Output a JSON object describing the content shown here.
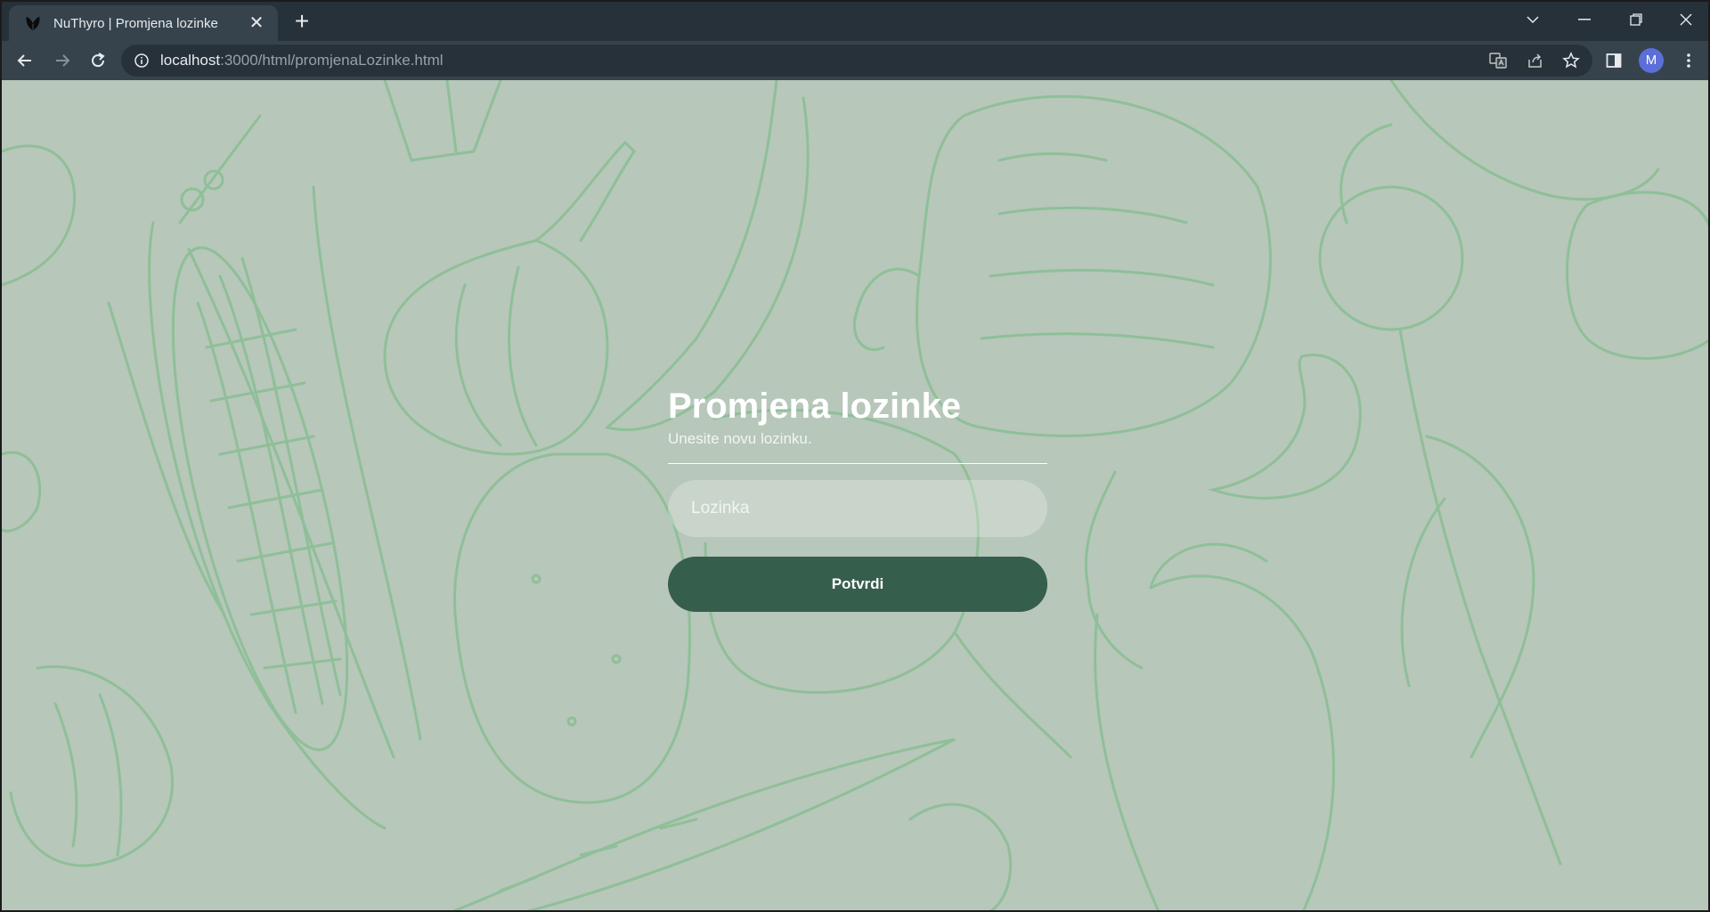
{
  "browser": {
    "tab": {
      "title": "NuThyro | Promjena lozinke"
    },
    "url": {
      "host": "localhost",
      "path": ":3000/html/promjenaLozinke.html"
    },
    "profile_initial": "M"
  },
  "page": {
    "heading": "Promjena lozinke",
    "subtitle": "Unesite novu lozinku.",
    "password_field": {
      "placeholder": "Lozinka",
      "value": ""
    },
    "submit_label": "Potvrdi"
  },
  "colors": {
    "background": "#b7c7ba",
    "illustration": "#8fbf98",
    "button": "#365e4c",
    "text": "#ffffff"
  }
}
